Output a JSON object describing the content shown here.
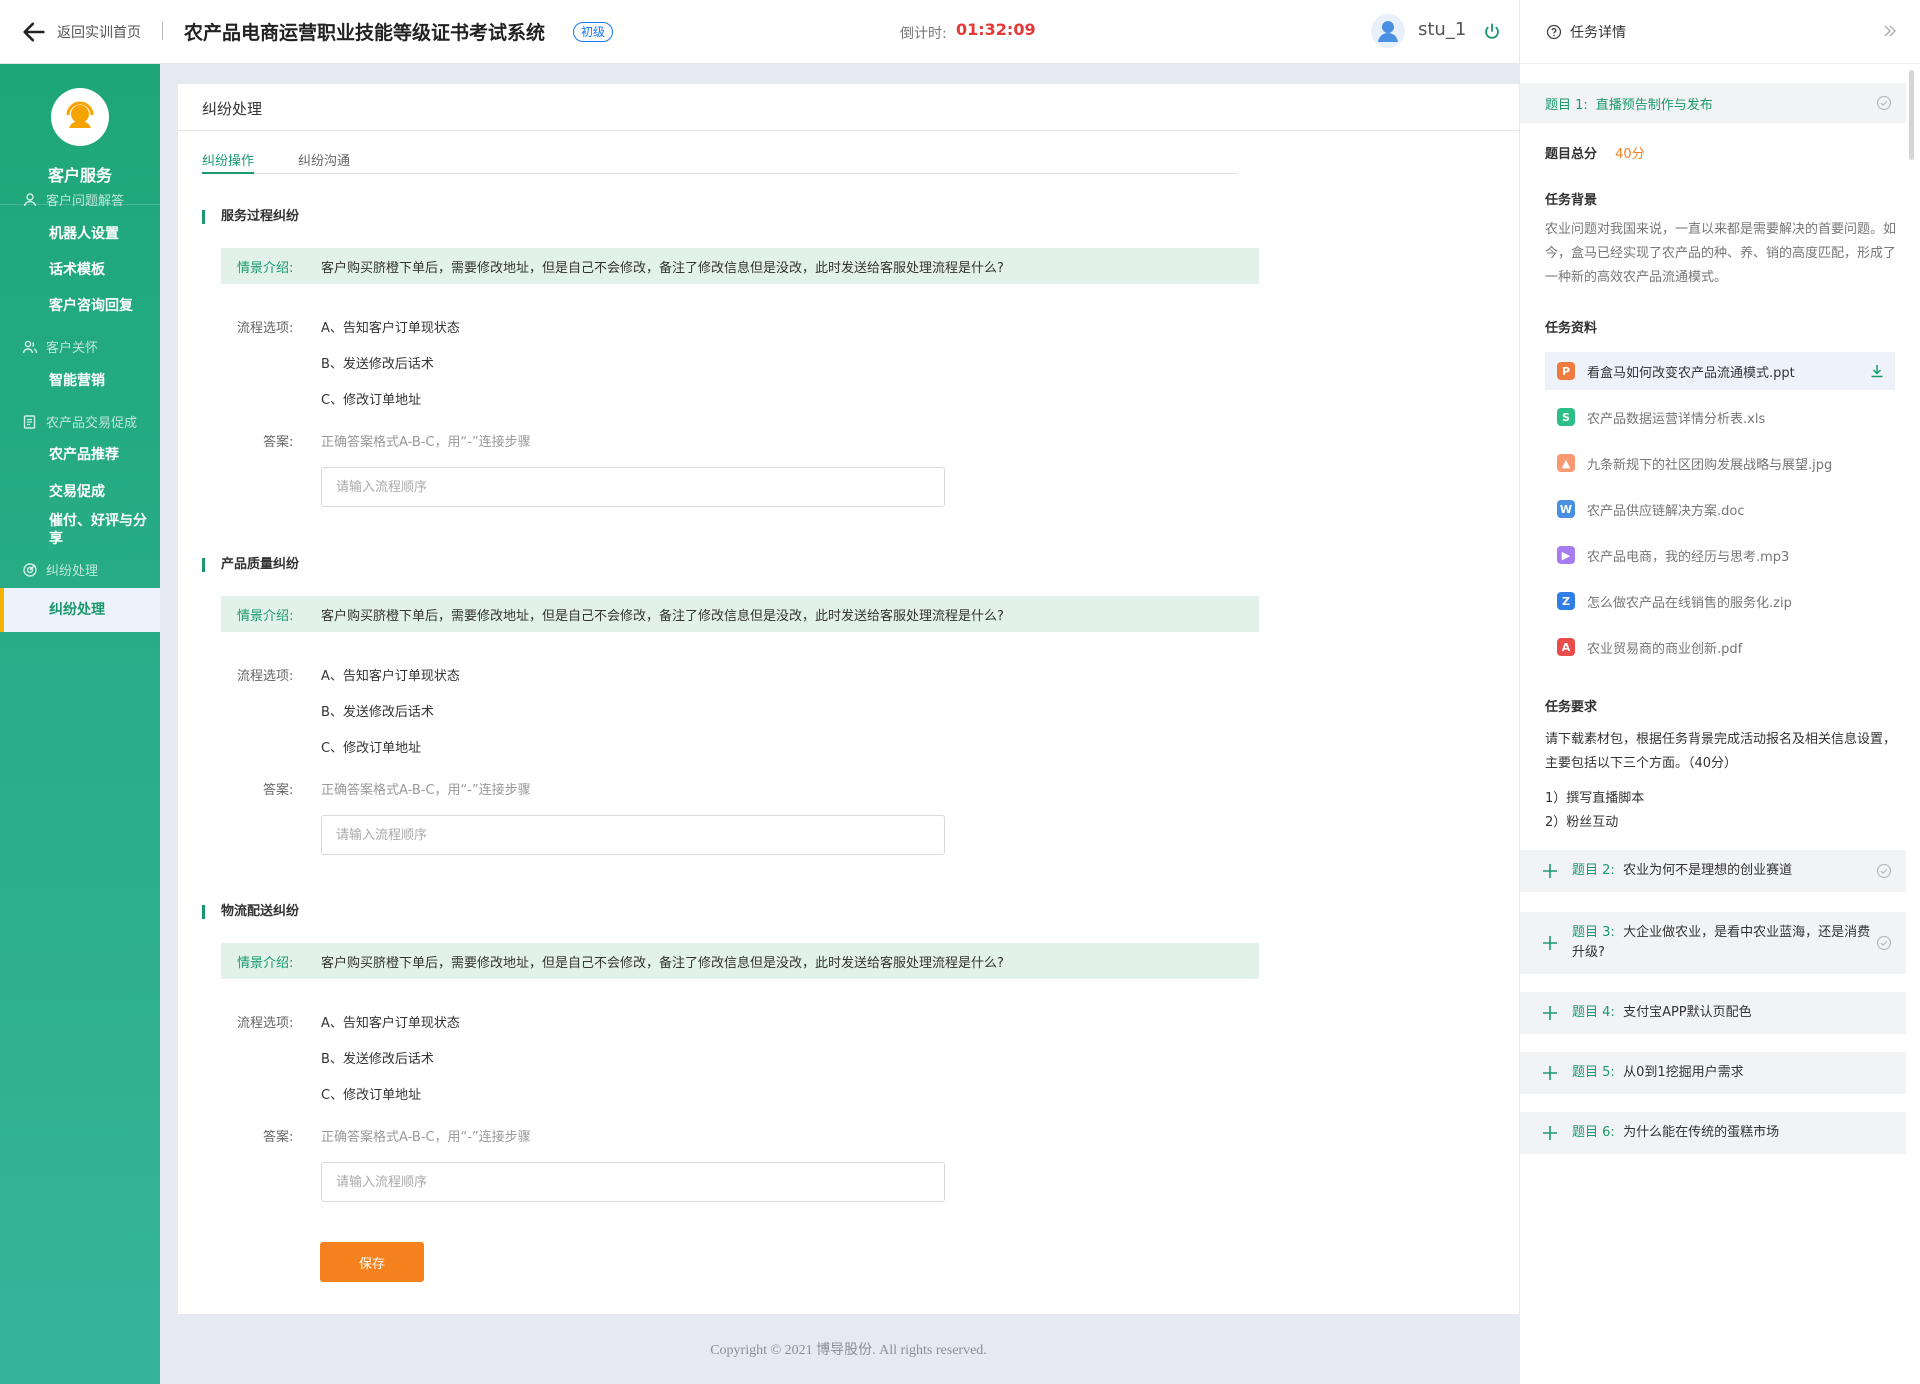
{
  "header": {
    "back_label": "返回实训首页",
    "title": "农产品电商运营职业技能等级证书考试系统",
    "level_badge": "初级",
    "timer_label": "倒计时:",
    "timer_value": "01:32:09",
    "username": "stu_1"
  },
  "sidebar": {
    "title": "客户服务",
    "groups": [
      {
        "label": "客户问题解答",
        "items": [
          "机器人设置",
          "话术模板",
          "客户咨询回复"
        ]
      },
      {
        "label": "客户关怀",
        "items": [
          "智能营销"
        ]
      },
      {
        "label": "农产品交易促成",
        "items": [
          "农产品推荐",
          "交易促成",
          "催付、好评与分享"
        ]
      },
      {
        "label": "纠纷处理",
        "items": [
          "纠纷处理"
        ]
      }
    ],
    "active_item": "纠纷处理"
  },
  "main": {
    "page_title": "纠纷处理",
    "tabs": [
      "纠纷操作",
      "纠纷沟通"
    ],
    "active_tab": "纠纷操作",
    "sections": [
      {
        "title": "服务过程纠纷",
        "scenario_label": "情景介绍:",
        "scenario_text": "客户购买脐橙下单后，需要修改地址，但是自己不会修改，备注了修改信息但是没改，此时发送给客服处理流程是什么?",
        "options_label": "流程选项:",
        "options": [
          "A、告知客户订单现状态",
          "B、发送修改后话术",
          "C、修改订单地址"
        ],
        "answer_label": "答案:",
        "answer_hint": "正确答案格式A-B-C，用“-”连接步骤",
        "answer_placeholder": "请输入流程顺序",
        "answer_value": ""
      },
      {
        "title": "产品质量纠纷",
        "scenario_label": "情景介绍:",
        "scenario_text": "客户购买脐橙下单后，需要修改地址，但是自己不会修改，备注了修改信息但是没改，此时发送给客服处理流程是什么?",
        "options_label": "流程选项:",
        "options": [
          "A、告知客户订单现状态",
          "B、发送修改后话术",
          "C、修改订单地址"
        ],
        "answer_label": "答案:",
        "answer_hint": "正确答案格式A-B-C，用“-”连接步骤",
        "answer_placeholder": "请输入流程顺序",
        "answer_value": ""
      },
      {
        "title": "物流配送纠纷",
        "scenario_label": "情景介绍:",
        "scenario_text": "客户购买脐橙下单后，需要修改地址，但是自己不会修改，备注了修改信息但是没改，此时发送给客服处理流程是什么?",
        "options_label": "流程选项:",
        "options": [
          "A、告知客户订单现状态",
          "B、发送修改后话术",
          "C、修改订单地址"
        ],
        "answer_label": "答案:",
        "answer_hint": "正确答案格式A-B-C，用“-”连接步骤",
        "answer_placeholder": "请输入流程顺序",
        "answer_value": ""
      }
    ],
    "save_label": "保存"
  },
  "footer": {
    "copyright": "Copyright © 2021 博导股份. All rights reserved."
  },
  "task_panel": {
    "title": "任务详情",
    "q1": {
      "num": "题目 1:",
      "title": "直播预告制作与发布"
    },
    "score_label": "题目总分",
    "score_value": "40分",
    "background_title": "任务背景",
    "background_text": "农业问题对我国来说，一直以来都是需要解决的首要问题。如今，盒马已经实现了农产品的种、养、销的高度匹配，形成了一种新的高效农产品流通模式。",
    "materials_title": "任务资料",
    "files": [
      {
        "name": "看盒马如何改变农产品流通模式.ppt",
        "icon": "ppt-icon",
        "color": "#f07b3f"
      },
      {
        "name": "农产品数据运营详情分析表.xls",
        "icon": "xls-icon",
        "color": "#2dbf8a"
      },
      {
        "name": "九条新规下的社区团购发展战略与展望.jpg",
        "icon": "image-icon",
        "color": "#f79a72"
      },
      {
        "name": "农产品供应链解决方案.doc",
        "icon": "doc-icon",
        "color": "#4a90e2"
      },
      {
        "name": "农产品电商，我的经历与思考.mp3",
        "icon": "audio-icon",
        "color": "#a67cf0"
      },
      {
        "name": "怎么做农产品在线销售的服务化.zip",
        "icon": "zip-icon",
        "color": "#2f7fe6"
      },
      {
        "name": "农业贸易商的商业创新.pdf",
        "icon": "pdf-icon",
        "color": "#e84c4c"
      }
    ],
    "requirements_title": "任务要求",
    "requirements_text": "请下载素材包，根据任务背景完成活动报名及相关信息设置，主要包括以下三个方面。（40分）",
    "requirement_items": [
      "1）撰写直播脚本",
      "2）粉丝互动"
    ],
    "other_questions": [
      {
        "num": "题目 2:",
        "title": "农业为何不是理想的创业赛道"
      },
      {
        "num": "题目 3:",
        "title": "大企业做农业，是看中农业蓝海，还是消费升级?"
      },
      {
        "num": "题目 4:",
        "title": "支付宝APP默认页配色"
      },
      {
        "num": "题目 5:",
        "title": "从0到1挖掘用户需求"
      },
      {
        "num": "题目 6:",
        "title": "为什么能在传统的蛋糕市场"
      }
    ]
  }
}
